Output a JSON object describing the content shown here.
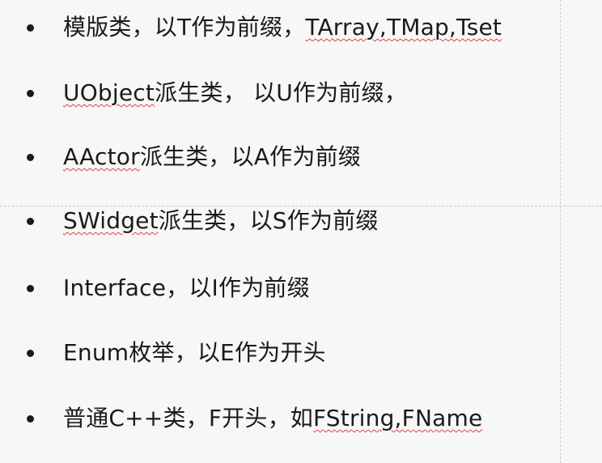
{
  "items": [
    {
      "parts": [
        {
          "text": "模版类，以T作为前缀，",
          "flag": false
        },
        {
          "text": "TArray,TMap,Tset",
          "flag": true
        }
      ]
    },
    {
      "parts": [
        {
          "text": "UObject",
          "flag": true
        },
        {
          "text": "派生类， 以U作为前缀，",
          "flag": false
        }
      ]
    },
    {
      "parts": [
        {
          "text": "AActor",
          "flag": true
        },
        {
          "text": "派生类，以A作为前缀",
          "flag": false
        }
      ]
    },
    {
      "parts": [
        {
          "text": "SWidget",
          "flag": true
        },
        {
          "text": "派生类，以S作为前缀",
          "flag": false
        }
      ]
    },
    {
      "parts": [
        {
          "text": "Interface，以I作为前缀",
          "flag": false
        }
      ]
    },
    {
      "parts": [
        {
          "text": "Enum枚举，以E作为开头",
          "flag": false
        }
      ]
    },
    {
      "parts": [
        {
          "text": "普通C++类，F开头，如",
          "flag": false
        },
        {
          "text": "FString,FName",
          "flag": true
        }
      ]
    }
  ]
}
